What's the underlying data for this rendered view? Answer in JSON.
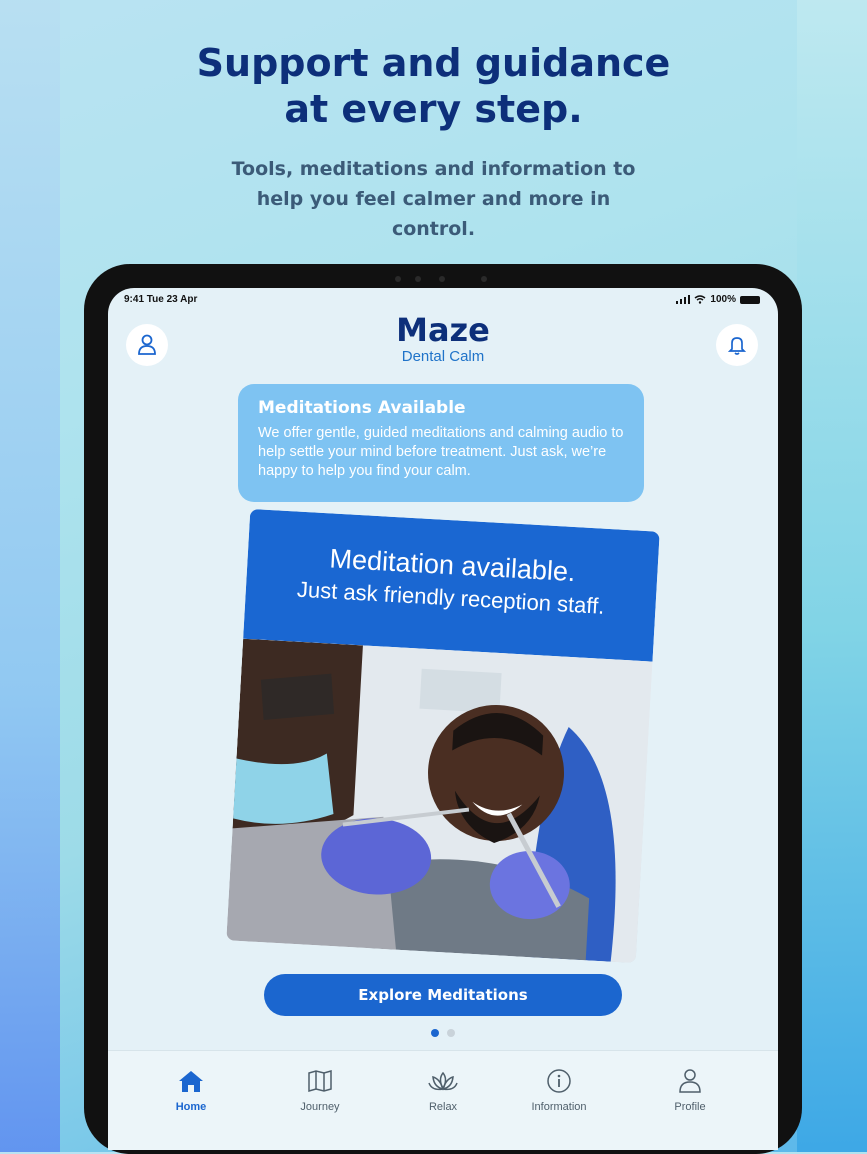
{
  "marketing": {
    "headline": "Support and guidance at every step.",
    "subline": "Tools, meditations and information to help you feel calmer and more in control."
  },
  "status_bar": {
    "time": "9:41  Tue 23 Apr",
    "battery": "100%"
  },
  "header": {
    "logo": "Maze",
    "subtitle": "Dental Calm",
    "profile_icon": "person-icon",
    "bell_icon": "bell-icon"
  },
  "info_card": {
    "title": "Meditations Available",
    "body": "We offer gentle, guided meditations and calming audio to help settle your mind before treatment. Just ask, we’re happy to help you find your calm."
  },
  "promo": {
    "line1": "Meditation available.",
    "line2": "Just ask friendly reception staff."
  },
  "cta": {
    "label": "Explore Meditations"
  },
  "pager": {
    "active_index": 0,
    "count": 2
  },
  "tabs": [
    {
      "label": "Home",
      "icon": "home-icon",
      "active": true
    },
    {
      "label": "Journey",
      "icon": "map-icon",
      "active": false
    },
    {
      "label": "Relax",
      "icon": "lotus-icon",
      "active": false
    },
    {
      "label": "Information",
      "icon": "info-icon",
      "active": false
    },
    {
      "label": "Profile",
      "icon": "person-icon",
      "active": false
    }
  ],
  "colors": {
    "brand_navy": "#0d2f7a",
    "brand_blue": "#1b66cf",
    "card_light_blue": "#7ec3f2"
  }
}
